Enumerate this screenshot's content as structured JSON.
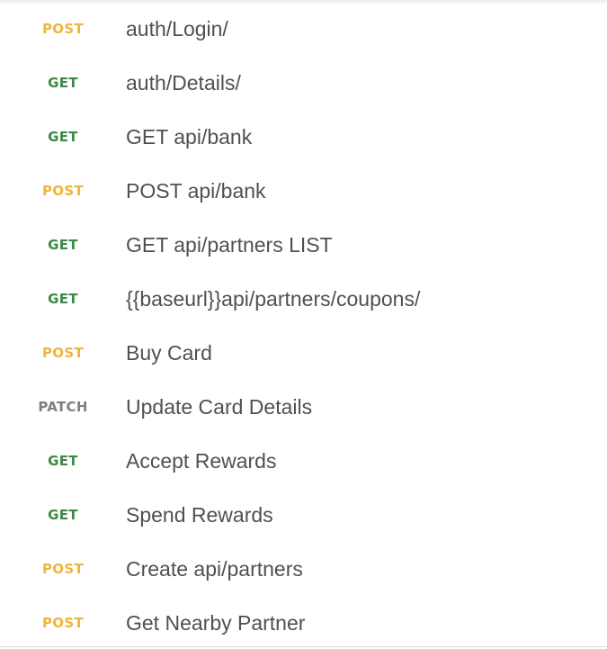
{
  "requests": [
    {
      "method": "POST",
      "name": "auth/Login/"
    },
    {
      "method": "GET",
      "name": "auth/Details/"
    },
    {
      "method": "GET",
      "name": "GET api/bank"
    },
    {
      "method": "POST",
      "name": "POST api/bank"
    },
    {
      "method": "GET",
      "name": "GET api/partners LIST"
    },
    {
      "method": "GET",
      "name": "{{baseurl}}api/partners/coupons/"
    },
    {
      "method": "POST",
      "name": "Buy Card"
    },
    {
      "method": "PATCH",
      "name": "Update Card Details"
    },
    {
      "method": "GET",
      "name": "Accept Rewards"
    },
    {
      "method": "GET",
      "name": "Spend Rewards"
    },
    {
      "method": "POST",
      "name": "Create api/partners"
    },
    {
      "method": "POST",
      "name": "Get Nearby Partner"
    }
  ],
  "colors": {
    "GET": "#3f8a45",
    "POST": "#efb53d",
    "PATCH": "#7f7f7f",
    "name_text": "#505050"
  }
}
